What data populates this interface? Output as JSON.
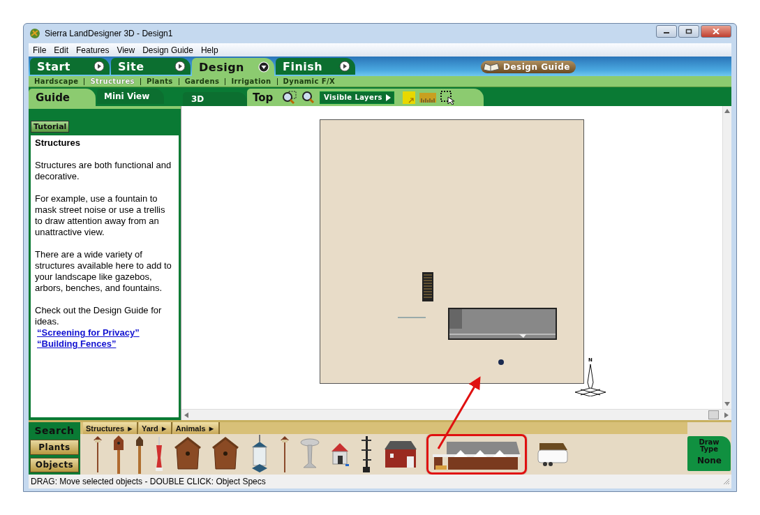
{
  "window": {
    "title": "Sierra LandDesigner 3D - Design1"
  },
  "menu": [
    "File",
    "Edit",
    "Features",
    "View",
    "Design Guide",
    "Help"
  ],
  "main_tabs": [
    {
      "label": "Start",
      "selected": false
    },
    {
      "label": "Site",
      "selected": false
    },
    {
      "label": "Design",
      "selected": true
    },
    {
      "label": "Finish",
      "selected": false
    }
  ],
  "design_guide_button": "Design Guide",
  "sub_nav": [
    {
      "label": "Hardscape",
      "selected": false
    },
    {
      "label": "Structures",
      "selected": true
    },
    {
      "label": "Plants",
      "selected": false
    },
    {
      "label": "Gardens",
      "selected": false
    },
    {
      "label": "Irrigation",
      "selected": false
    },
    {
      "label": "Dynamic F/X",
      "selected": false
    }
  ],
  "panel_tabs": [
    {
      "label": "Guide",
      "selected": true
    },
    {
      "label": "Mini View",
      "selected": false
    }
  ],
  "view_tabs": [
    {
      "label": "3D",
      "selected": false
    },
    {
      "label": "Top",
      "selected": true
    }
  ],
  "visible_layers": "Visible Layers",
  "guide": {
    "tutorial_button": "Tutorial",
    "heading": "Structures",
    "paragraphs": [
      "Structures are both functional and decorative.",
      "For example, use a fountain to mask street noise or use a trellis to draw attention away from an unattractive view.",
      "There are a wide variety of structures available here to add to your landscape like gazebos, arbors, benches, and fountains.",
      "Check out the Design Guide for ideas."
    ],
    "links": [
      "“Screening for Privacy”",
      "“Building Fences”"
    ]
  },
  "canvas": {
    "compass_label": "N"
  },
  "side_buttons": [
    {
      "label": "Search",
      "selected": true
    },
    {
      "label": "Plants",
      "selected": false
    },
    {
      "label": "Objects",
      "selected": false
    }
  ],
  "category_tabs": [
    "Structures ►",
    "Yard ►",
    "Animals ►"
  ],
  "objects": [
    {
      "kind": "pole",
      "highlighted": false
    },
    {
      "kind": "birdhouse-pole",
      "highlighted": false
    },
    {
      "kind": "lantern",
      "highlighted": false
    },
    {
      "kind": "feeder",
      "highlighted": false
    },
    {
      "kind": "birdhouse",
      "highlighted": false
    },
    {
      "kind": "birdhouse",
      "highlighted": false
    },
    {
      "kind": "hanging-feeder",
      "highlighted": false
    },
    {
      "kind": "pole",
      "highlighted": false
    },
    {
      "kind": "birdbath",
      "highlighted": false
    },
    {
      "kind": "doghouse",
      "highlighted": false
    },
    {
      "kind": "stand",
      "highlighted": false
    },
    {
      "kind": "barn",
      "highlighted": false
    },
    {
      "kind": "shelter",
      "highlighted": true
    },
    {
      "kind": "trailer",
      "highlighted": false
    }
  ],
  "draw_type": {
    "label": "Draw Type",
    "value": "None"
  },
  "status_bar": "DRAG:  Move selected objects - DOUBLE CLICK: Object Specs"
}
